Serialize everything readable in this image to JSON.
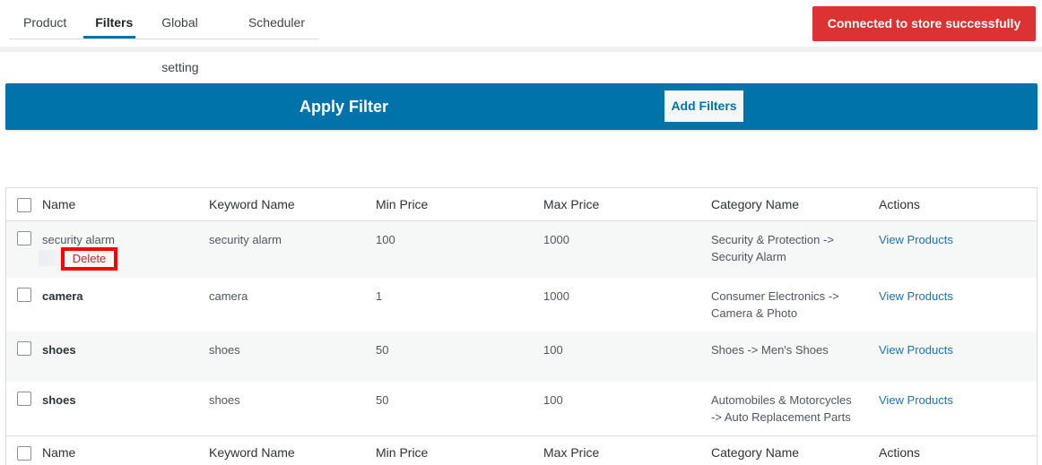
{
  "tabs": [
    {
      "label": "Product",
      "active": false
    },
    {
      "label": "Filters",
      "active": true
    },
    {
      "label": "Global setting",
      "active": false
    },
    {
      "label": "Scheduler",
      "active": false
    }
  ],
  "status_banner": {
    "text": "Connected to store successfully",
    "color": "#dc3232"
  },
  "filter_bar": {
    "title": "Apply Filter",
    "add_button": "Add Filters",
    "color": "#0073aa"
  },
  "table": {
    "columns": [
      "Name",
      "Keyword Name",
      "Min Price",
      "Max Price",
      "Category Name",
      "Actions"
    ],
    "rows": [
      {
        "name": "security alarm",
        "keyword": "security alarm",
        "min_price": "100",
        "max_price": "1000",
        "category_line1": "Security & Protection ->",
        "category_line2": "Security Alarm",
        "action": "View Products",
        "row_action": "Delete"
      },
      {
        "name": "camera",
        "keyword": "camera",
        "min_price": "1",
        "max_price": "1000",
        "category_line1": "Consumer Electronics ->",
        "category_line2": "Camera & Photo",
        "action": "View Products"
      },
      {
        "name": "shoes",
        "keyword": "shoes",
        "min_price": "50",
        "max_price": "100",
        "category_line1": "Shoes -> Men's Shoes",
        "category_line2": "",
        "action": "View Products"
      },
      {
        "name": "shoes",
        "keyword": "shoes",
        "min_price": "50",
        "max_price": "100",
        "category_line1": "Automobiles & Motorcycles",
        "category_line2": "-> Auto Replacement Parts",
        "action": "View Products"
      }
    ]
  }
}
